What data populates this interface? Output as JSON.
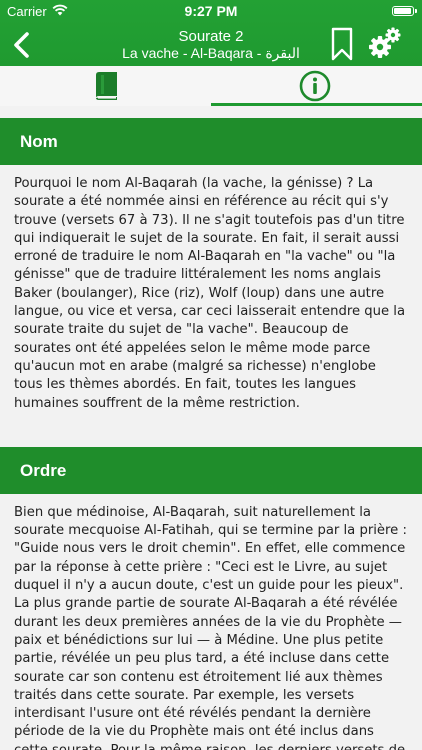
{
  "status_bar": {
    "carrier": "Carrier",
    "time": "9:27 PM"
  },
  "header": {
    "title": "Sourate 2",
    "subtitle": "La vache - Al-Baqara - البقرة",
    "icons": [
      "back-chevron-icon",
      "bookmark-icon",
      "settings-gear-icon"
    ]
  },
  "tabs": [
    {
      "icon": "book-icon",
      "selected": false
    },
    {
      "icon": "info-icon",
      "selected": true
    }
  ],
  "colors": {
    "brand_green": "#1f9a30",
    "section_green": "#1f8d2b",
    "background": "#f2f2f2"
  },
  "sections": [
    {
      "title": "Nom",
      "text": "Pourquoi le nom Al-Baqarah (la vache, la génisse) ? La sourate a été nommée ainsi en référence au récit qui s'y trouve (versets 67 à 73). Il ne s'agit toutefois pas d'un titre qui indiquerait le sujet de la sourate. En fait, il serait aussi erroné de traduire le nom Al-Baqarah en \"la vache\" ou \"la génisse\" que de traduire littéralement les noms anglais Baker (boulanger), Rice (riz), Wolf (loup) dans une autre langue, ou vice et versa, car ceci laisserait entendre que la sourate traite du sujet de \"la vache\". Beaucoup de sourates ont été appelées selon le même mode parce qu'aucun mot en arabe (malgré sa richesse) n'englobe tous les thèmes abordés. En fait, toutes les langues humaines souffrent de la même restriction."
    },
    {
      "title": "Ordre",
      "text": "Bien que médinoise, Al-Baqarah, suit naturellement la sourate mecquoise Al-Fatihah, qui se termine par la prière : \"Guide nous vers le droit chemin\". En effet, elle commence par la réponse à cette prière : \"Ceci est le Livre, au sujet duquel il n'y a aucun doute, c'est un guide pour les pieux\". La plus grande partie de sourate Al-Baqarah a été révélée durant les deux premières années de la vie du Prophète — paix et bénédictions sur lui — à Médine. Une plus petite partie, révélée un peu plus tard, a été incluse dans cette sourate car son contenu est étroitement lié aux thèmes traités dans cette sourate. Par exemple, les versets interdisant l'usure ont été révélés pendant la dernière période de la vie du Prophète mais ont été inclus dans cette sourate. Pour la même raison, les derniers versets de cette"
    }
  ]
}
